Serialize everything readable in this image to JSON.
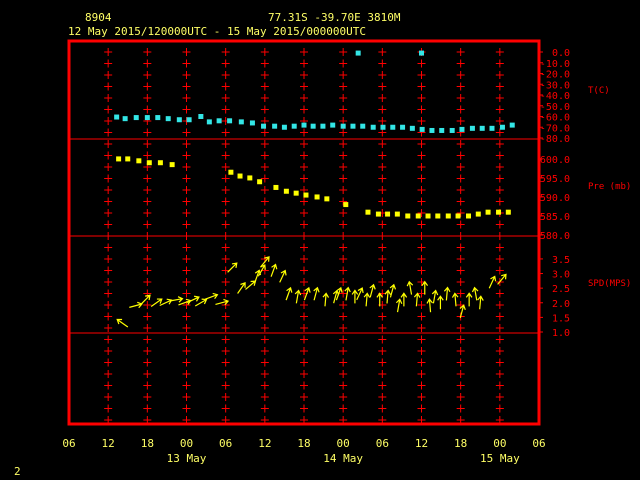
{
  "header": {
    "station_id": "8904",
    "location": "77.31S   -39.70E   3810M",
    "time_range": "12 May 2015/120000UTC - 15 May 2015/000000UTC"
  },
  "footer": {
    "page_number": "2"
  },
  "colors": {
    "frame": "#ff0000",
    "text": "#ffff66",
    "temperature": "#33e6e6",
    "pressure": "#ffff00",
    "wind": "#ffff00"
  },
  "chart_data": {
    "type": "scatter",
    "x_axis": {
      "ticks": [
        "06",
        "12",
        "18",
        "00",
        "06",
        "12",
        "18",
        "00",
        "06",
        "12",
        "18",
        "00",
        "06"
      ],
      "dates": [
        "13 May",
        "14 May",
        "15 May"
      ],
      "unit": "hours since 12 May 2015 06 UTC",
      "range": [
        0,
        72
      ]
    },
    "panels": [
      {
        "name": "temperature",
        "label": "T(C)",
        "ylim": [
          -80,
          0
        ],
        "ticks": [
          "0.0",
          "-10.0",
          "-20.0",
          "-30.0",
          "-40.0",
          "-50.0",
          "-60.0",
          "-70.0",
          "-80.0"
        ],
        "x": [
          7.3,
          8.6,
          10.3,
          12.0,
          13.6,
          15.2,
          16.9,
          18.4,
          20.2,
          21.5,
          23.0,
          24.6,
          26.4,
          28.1,
          29.8,
          31.5,
          33.0,
          34.5,
          36.0,
          37.4,
          38.9,
          40.4,
          42.0,
          43.5,
          45.0,
          46.6,
          48.1,
          49.6,
          51.1,
          52.6,
          54.1,
          55.6,
          57.1,
          58.7,
          60.2,
          61.8,
          63.3,
          64.8,
          66.4,
          67.9
        ],
        "values": [
          -60.5,
          -62,
          -61,
          -61,
          -61,
          -62,
          -63,
          -63,
          -60,
          -65,
          -64,
          -64,
          -65,
          -66,
          -69,
          -69,
          -70,
          -69,
          -68,
          -69,
          -69,
          -68,
          -69,
          -69,
          -69,
          -70,
          -70,
          -70,
          -70,
          -71,
          -72,
          -73,
          -73,
          -73,
          -72,
          -71,
          -71,
          -71,
          -70,
          -68
        ],
        "outliers_x": [
          44.3,
          54.0
        ],
        "outliers_values": [
          -1,
          -1
        ]
      },
      {
        "name": "pressure",
        "label": "Pre (mb)",
        "ylim": [
          580,
          603
        ],
        "ticks": [
          "600.0",
          "595.0",
          "590.0",
          "585.0",
          "580.0"
        ],
        "x": [
          7.6,
          9.0,
          10.7,
          12.3,
          14.0,
          15.8,
          24.8,
          26.2,
          27.7,
          29.2,
          31.7,
          33.3,
          34.8,
          36.3,
          38.0,
          39.5,
          42.4,
          45.8,
          47.4,
          48.8,
          50.3,
          51.9,
          53.5,
          55.0,
          56.5,
          58.1,
          59.6,
          61.2,
          62.7,
          64.2,
          65.8,
          67.3
        ],
        "values": [
          600,
          600,
          599.5,
          599,
          599,
          598.5,
          596.5,
          595.5,
          595,
          594,
          592.5,
          591.5,
          591,
          590.5,
          590,
          589.5,
          588,
          586,
          585.5,
          585.5,
          585.5,
          585,
          585,
          585,
          585,
          585,
          585,
          585,
          585.5,
          586,
          586,
          586
        ]
      },
      {
        "name": "wind_speed",
        "label": "SPD(MPS)",
        "ylim": [
          1,
          3.6
        ],
        "ticks": [
          "3.5",
          "3.0",
          "2.5",
          "2.0",
          "1.5",
          "1.0"
        ],
        "x": [
          8.2,
          10.2,
          11.7,
          13.4,
          14.8,
          16.4,
          17.7,
          19.0,
          20.2,
          21.8,
          23.4,
          25.0,
          26.4,
          27.8,
          28.8,
          29.5,
          30.0,
          31.3,
          32.7,
          33.6,
          35.0,
          36.4,
          37.8,
          39.3,
          40.8,
          41.3,
          42.6,
          43.8,
          44.5,
          45.6,
          46.4,
          47.6,
          48.8,
          49.5,
          50.5,
          51.3,
          52.3,
          53.3,
          54.5,
          55.3,
          56.0,
          56.9,
          57.9,
          59.2,
          60.2,
          61.3,
          62.3,
          63.0,
          64.8,
          66.3
        ],
        "values": [
          1.3,
          1.9,
          2.1,
          2.0,
          2.0,
          2.1,
          2.0,
          2.1,
          2.0,
          2.2,
          2.0,
          3.2,
          2.5,
          2.6,
          2.9,
          3.1,
          3.4,
          3.1,
          2.9,
          2.3,
          2.2,
          2.3,
          2.3,
          2.1,
          2.2,
          2.3,
          2.3,
          2.2,
          2.3,
          2.1,
          2.4,
          2.1,
          2.2,
          2.4,
          1.9,
          2.1,
          2.5,
          2.1,
          2.5,
          1.9,
          2.2,
          2.0,
          2.3,
          2.1,
          1.7,
          2.1,
          2.3,
          2.0,
          2.7,
          2.8
        ],
        "directions_deg": [
          125,
          255,
          225,
          235,
          245,
          260,
          250,
          245,
          240,
          250,
          255,
          225,
          215,
          230,
          200,
          210,
          220,
          200,
          205,
          200,
          190,
          200,
          195,
          185,
          195,
          200,
          190,
          180,
          205,
          185,
          195,
          180,
          185,
          195,
          190,
          180,
          170,
          185,
          180,
          175,
          190,
          180,
          185,
          175,
          195,
          180,
          170,
          185,
          205,
          220
        ]
      }
    ]
  }
}
